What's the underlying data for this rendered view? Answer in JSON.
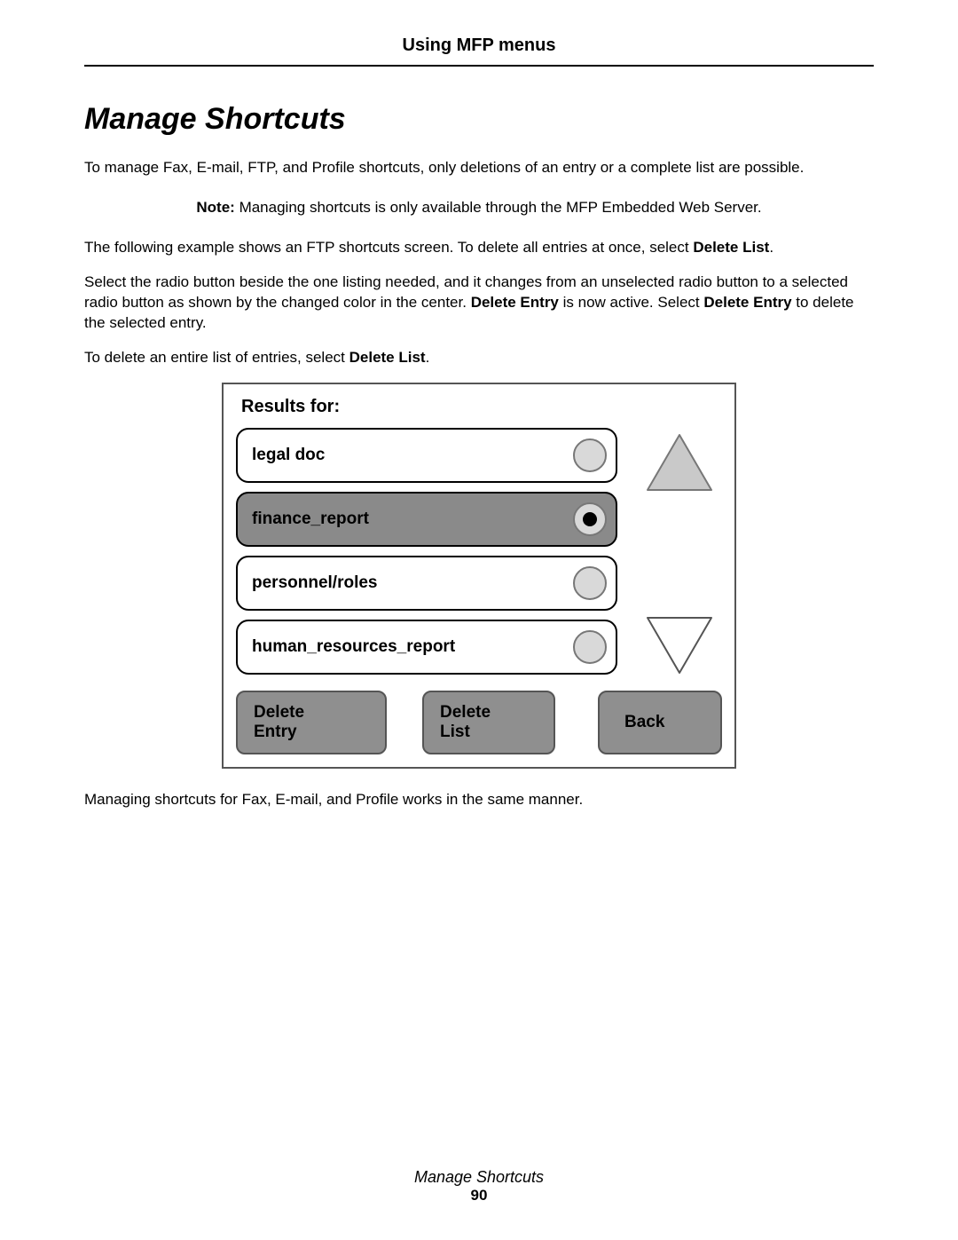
{
  "header": {
    "running_head": "Using MFP menus"
  },
  "section": {
    "title": "Manage Shortcuts"
  },
  "paragraphs": {
    "p1": "To manage Fax, E-mail, FTP, and Profile shortcuts, only deletions of an entry or a complete list are possible.",
    "note_prefix": "Note:",
    "note_body": " Managing shortcuts is only available through the MFP Embedded Web Server.",
    "p2a": "The following example shows an FTP shortcuts screen. To delete all entries at once, select ",
    "p2b": "Delete List",
    "p2c": ".",
    "p3a": "Select the radio button beside the one listing needed, and it changes from an unselected radio button to a selected radio button as shown by the changed color in the center. ",
    "p3b": "Delete Entry",
    "p3c": " is now active. Select ",
    "p3d": "Delete Entry",
    "p3e": " to delete the selected entry.",
    "p4a": "To delete an entire list of entries, select ",
    "p4b": "Delete List",
    "p4c": ".",
    "p5": "Managing shortcuts for Fax, E-mail, and Profile works in the same manner."
  },
  "screen": {
    "results_for": "Results for:",
    "entries": [
      {
        "label": "legal doc",
        "selected": false
      },
      {
        "label": "finance_report",
        "selected": true
      },
      {
        "label": "personnel/roles",
        "selected": false
      },
      {
        "label": "human_resources_report",
        "selected": false
      }
    ],
    "buttons": {
      "delete_entry_l1": "Delete",
      "delete_entry_l2": "Entry",
      "delete_list_l1": "Delete",
      "delete_list_l2": "List",
      "back": "Back"
    }
  },
  "footer": {
    "title": "Manage Shortcuts",
    "page_number": "90"
  }
}
